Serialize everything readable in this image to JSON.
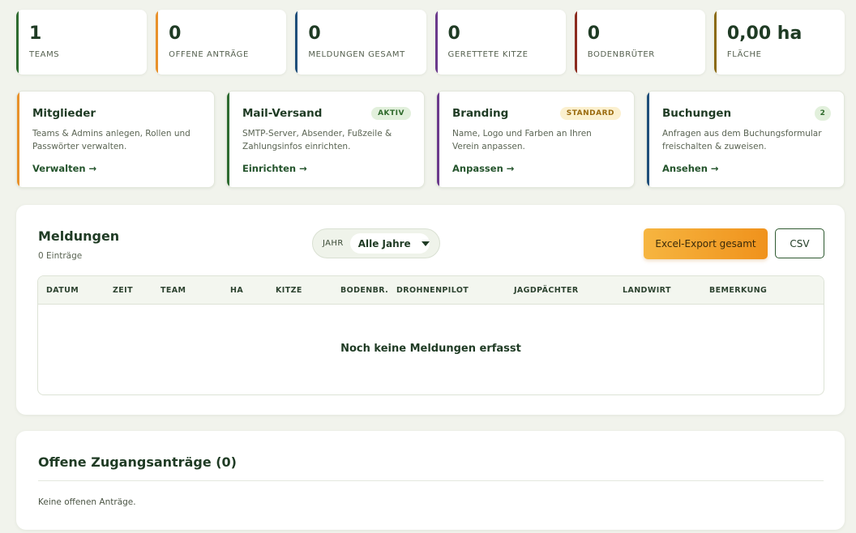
{
  "stats": [
    {
      "value": "1",
      "label": "TEAMS",
      "color": "#2e6b30"
    },
    {
      "value": "0",
      "label": "OFFENE ANTRÄGE",
      "color": "#e8912b"
    },
    {
      "value": "0",
      "label": "MELDUNGEN GESAMT",
      "color": "#1f4e7a"
    },
    {
      "value": "0",
      "label": "GERETTETE KITZE",
      "color": "#6b3a8c"
    },
    {
      "value": "0",
      "label": "BODENBRÜTER",
      "color": "#8b2a1e"
    },
    {
      "value": "0,00 ha",
      "label": "FLÄCHE",
      "color": "#8b6a12"
    }
  ],
  "features": [
    {
      "title": "Mitglieder",
      "badge": "",
      "desc": "Teams & Admins anlegen, Rollen und Passwörter verwalten.",
      "link": "Verwalten →",
      "color": "#e8912b"
    },
    {
      "title": "Mail-Versand",
      "badge": "AKTIV",
      "desc": "SMTP-Server, Absender, Fußzeile & Zahlungsinfos einrichten.",
      "link": "Einrichten →",
      "color": "#2e6b30"
    },
    {
      "title": "Branding",
      "badge": "STANDARD",
      "desc": "Name, Logo und Farben an Ihren Verein anpassen.",
      "link": "Anpassen →",
      "color": "#6b3a8c"
    },
    {
      "title": "Buchungen",
      "badge": "2",
      "desc": "Anfragen aus dem Buchungsformular freischalten & zuweisen.",
      "link": "Ansehen →",
      "color": "#1f4e7a"
    }
  ],
  "meldungen": {
    "title": "Meldungen",
    "count": "0 Einträge",
    "year_label": "JAHR",
    "year_value": "Alle Jahre",
    "excel_button": "Excel-Export gesamt",
    "csv_button": "CSV",
    "columns": [
      "DATUM",
      "ZEIT",
      "TEAM",
      "HA",
      "KITZE",
      "BODENBR.",
      "DROHNENPILOT",
      "JAGDPÄCHTER",
      "LANDWIRT",
      "BEMERKUNG"
    ],
    "empty_text": "Noch keine Meldungen erfasst"
  },
  "zugang": {
    "title": "Offene Zugangsanträge (0)",
    "empty_text": "Keine offenen Anträge."
  }
}
